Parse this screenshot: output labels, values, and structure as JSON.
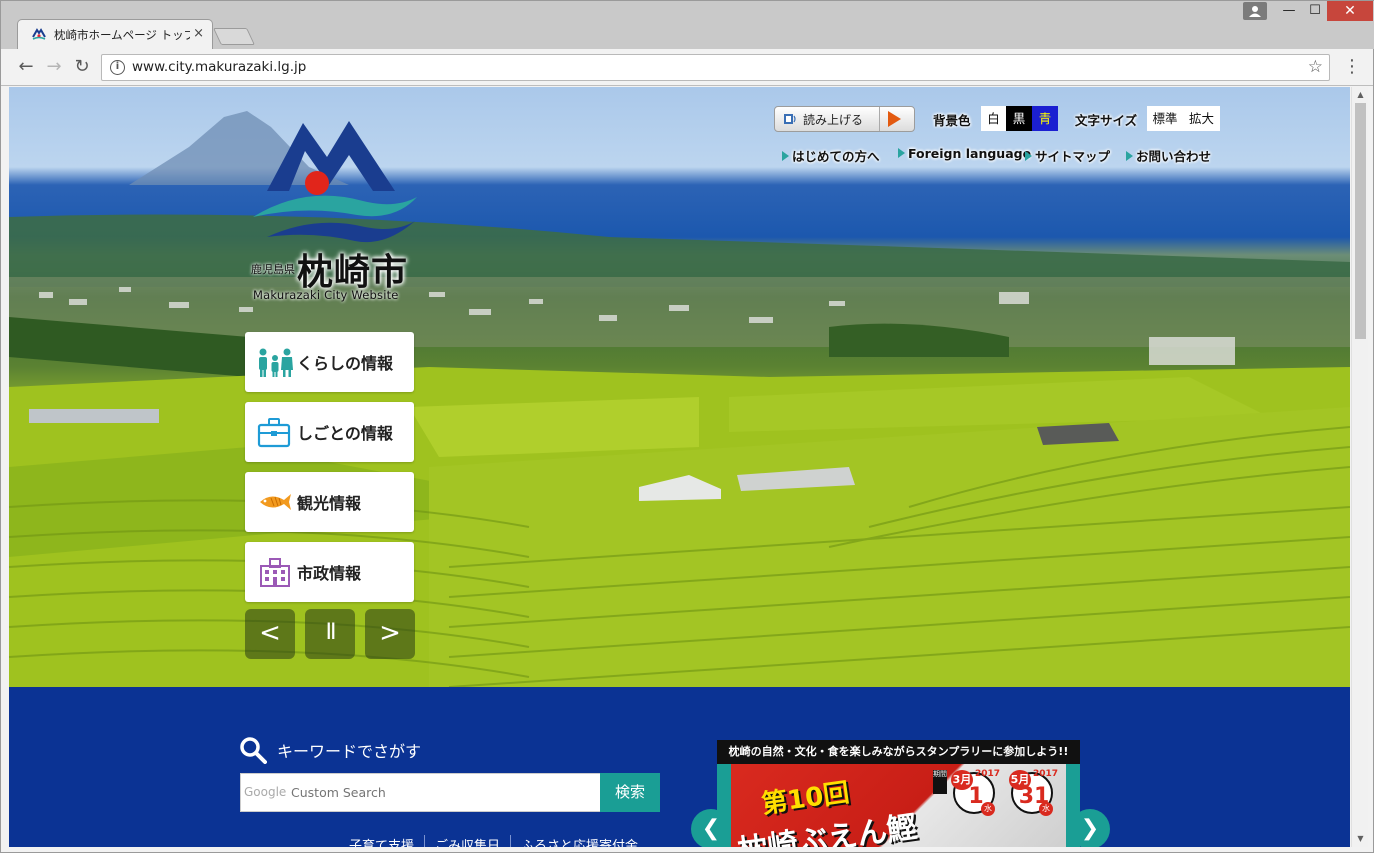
{
  "browser": {
    "tab_title": "枕崎市ホームページ トップペ",
    "tab_close": "×",
    "url": "www.city.makurazaki.lg.jp",
    "back": "←",
    "forward": "→",
    "reload": "↻",
    "star": "☆",
    "menu": "⋮",
    "win_min": "—",
    "win_max": "☐",
    "win_close": "✕"
  },
  "site": {
    "logo": {
      "prefecture": "鹿児島県",
      "city": "枕崎市",
      "english": "Makurazaki City  Website"
    },
    "read_aloud": {
      "label": "読み上げる"
    },
    "background": {
      "label": "背景色",
      "white": "白",
      "black": "黒",
      "blue": "青"
    },
    "font_size": {
      "label": "文字サイズ",
      "standard": "標準",
      "large": "拡大"
    },
    "top_links": [
      "はじめての方へ",
      "Foreign language",
      "サイトマップ",
      "お問い合わせ"
    ],
    "categories": [
      {
        "label": "くらしの情報",
        "icon": "family-icon"
      },
      {
        "label": "しごとの情報",
        "icon": "briefcase-icon"
      },
      {
        "label": "観光情報",
        "icon": "fish-icon"
      },
      {
        "label": "市政情報",
        "icon": "city-hall-icon"
      }
    ],
    "slider": {
      "prev": "<",
      "pause": "II",
      "next": ">"
    },
    "search": {
      "title": "キーワードでさがす",
      "brand": "Google",
      "placeholder": "Custom Search",
      "button": "検索"
    },
    "quick_links": [
      "子育て支援",
      "ごみ収集日",
      "ふるさと応援寄付金"
    ],
    "banner": {
      "headline": "枕崎の自然・文化・食を楽しみながらスタンプラリーに参加しよう!!",
      "title1": "第10回",
      "title2": "枕崎ぶえん鰹",
      "period_label": "期間",
      "start": {
        "month": "3月",
        "year": "2017",
        "day": "1",
        "weekday": "水"
      },
      "end": {
        "month": "5月",
        "year": "2017",
        "day": "31",
        "weekday": "水"
      },
      "prev": "❮",
      "next": "❯"
    }
  },
  "colors": {
    "section_blue": "#0b3394",
    "accent_teal": "#1a9e95",
    "play_orange": "#e35a10"
  }
}
